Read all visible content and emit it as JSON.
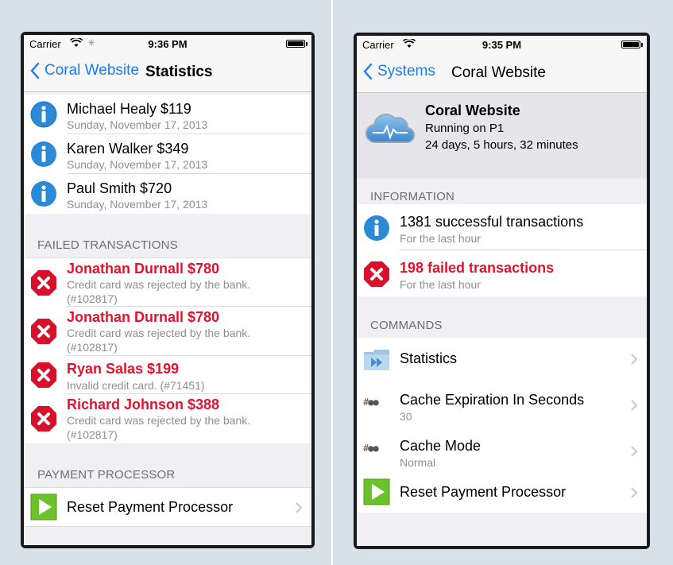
{
  "left": {
    "status": {
      "carrier": "Carrier",
      "time": "9:36 PM"
    },
    "nav": {
      "back_label": "Coral Website",
      "title": "Statistics"
    },
    "success_rows": [
      {
        "name": "Michael Healy $119",
        "date": "Sunday, November 17, 2013"
      },
      {
        "name": "Karen Walker $349",
        "date": "Sunday, November 17, 2013"
      },
      {
        "name": "Paul Smith $720",
        "date": "Sunday, November 17, 2013"
      }
    ],
    "failed_header": "FAILED TRANSACTIONS",
    "failed_rows": [
      {
        "name": "Jonathan Durnall $780",
        "detail": "Credit card was rejected by the bank.",
        "ref": "(#102817)"
      },
      {
        "name": "Jonathan Durnall $780",
        "detail": "Credit card was rejected by the bank.",
        "ref": "(#102817)"
      },
      {
        "name": "Ryan Salas $199",
        "detail": "Invalid credit card. (#71451)",
        "ref": ""
      },
      {
        "name": "Richard Johnson $388",
        "detail": "Credit card was rejected by the bank.",
        "ref": "(#102817)"
      }
    ],
    "payment_header": "PAYMENT PROCESSOR",
    "reset_label": "Reset Payment Processor"
  },
  "right": {
    "status": {
      "carrier": "Carrier",
      "time": "9:35 PM"
    },
    "nav": {
      "back_label": "Systems",
      "title": "Coral Website"
    },
    "system": {
      "name": "Coral Website",
      "running_on": "Running on P1",
      "uptime": "24 days, 5 hours, 32 minutes"
    },
    "info_header": "INFORMATION",
    "info_rows": [
      {
        "title": "1381 successful transactions",
        "sub": "For the last hour"
      },
      {
        "title": "198 failed transactions",
        "sub": "For the last hour"
      }
    ],
    "commands_header": "COMMANDS",
    "commands": [
      {
        "label": "Statistics",
        "value": ""
      },
      {
        "label": "Cache Expiration In Seconds",
        "value": "30"
      },
      {
        "label": "Cache Mode",
        "value": "Normal"
      },
      {
        "label": "Reset Payment Processor",
        "value": ""
      }
    ],
    "colors": {
      "accent": "#1a7cf5",
      "failed": "#e4122f",
      "info": "#2a8ad8",
      "play": "#6cc22a"
    }
  }
}
